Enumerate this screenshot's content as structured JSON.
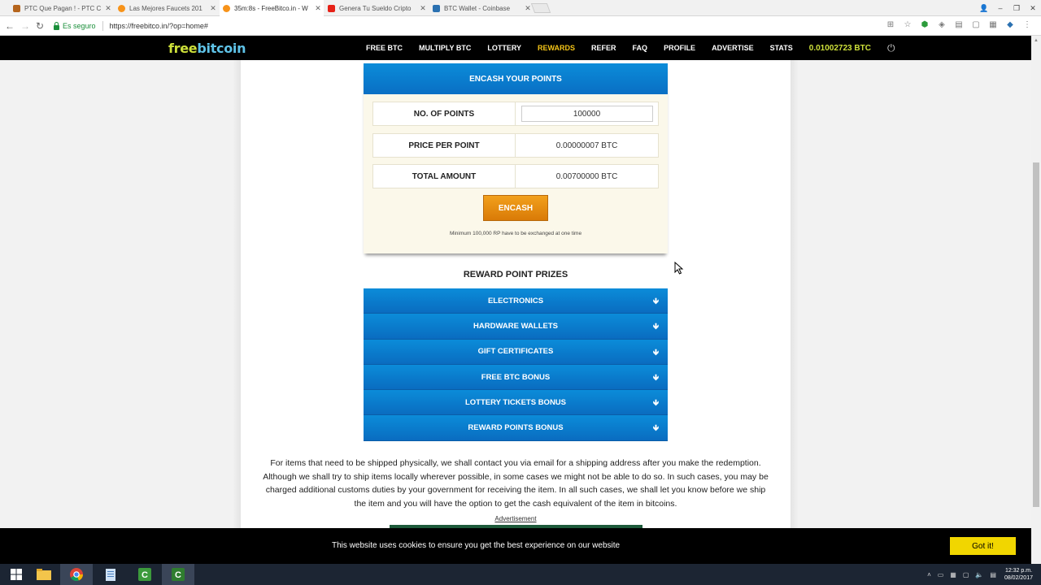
{
  "browser": {
    "tabs": [
      {
        "title": "PTC Que Pagan ! - PTC C",
        "favicon_color": "#b5651d",
        "active": false
      },
      {
        "title": "Las Mejores Faucets 201",
        "favicon_color": "#f7931a",
        "active": false
      },
      {
        "title": "35m:8s - FreeBitco.in - W",
        "favicon_color": "#f7931a",
        "active": true
      },
      {
        "title": "Genera Tu Sueldo Cripto",
        "favicon_color": "#e62117",
        "active": false
      },
      {
        "title": "BTC Wallet - Coinbase",
        "favicon_color": "#2b71b1",
        "active": false
      }
    ],
    "secure_label": "Es seguro",
    "url": "https://freebitco.in/?op=home#"
  },
  "site": {
    "logo_part1": "free",
    "logo_part2": "bitcoin",
    "menu": [
      "FREE BTC",
      "MULTIPLY BTC",
      "LOTTERY",
      "REWARDS",
      "REFER",
      "FAQ",
      "PROFILE",
      "ADVERTISE",
      "STATS"
    ],
    "active_menu": "REWARDS",
    "balance": "0.01002723 BTC",
    "power_icon": "⏻"
  },
  "encash": {
    "header": "ENCASH YOUR POINTS",
    "points_label": "NO. OF POINTS",
    "points_value": "100000",
    "price_label": "PRICE PER POINT",
    "price_value": "0.00000007 BTC",
    "total_label": "TOTAL AMOUNT",
    "total_value": "0.00700000 BTC",
    "button": "ENCASH",
    "note": "Minimum 100,000 RP have to be exchanged at one time"
  },
  "prizes": {
    "title": "REWARD POINT PRIZES",
    "items": [
      "ELECTRONICS",
      "HARDWARE WALLETS",
      "GIFT CERTIFICATES",
      "FREE BTC BONUS",
      "LOTTERY TICKETS BONUS",
      "REWARD POINTS BONUS"
    ],
    "arrow": "🡻"
  },
  "shipping_text": "For items that need to be shipped physically, we shall contact you via email for a shipping address after you make the redemption. Although we shall try to ship items locally wherever possible, in some cases we might not be able to do so. In such cases, you may be charged additional customs duties by your government for receiving the item. In all such cases, we shall let you know before we ship the item and you will have the option to get the cash equivalent of the item in bitcoins.",
  "ad_label": "Advertisement",
  "cookie": {
    "text": "This website uses cookies to ensure you get the best experience on our website",
    "button": "Got it!"
  },
  "taskbar": {
    "time": "12:32 p.m.",
    "date": "08/02/2017"
  }
}
